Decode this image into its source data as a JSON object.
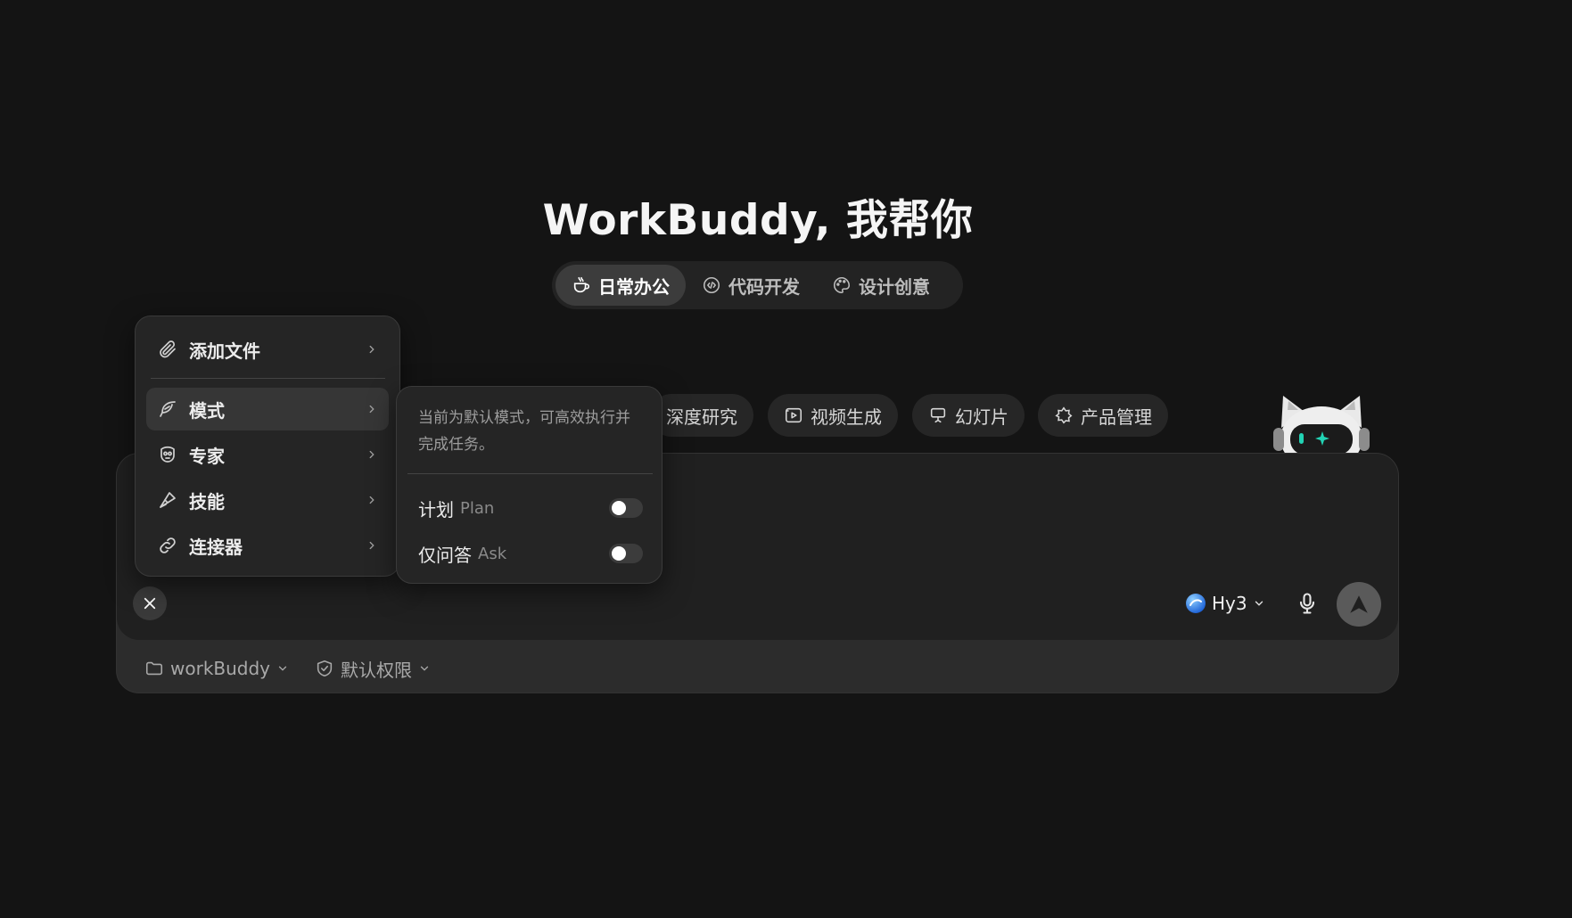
{
  "hero": {
    "title": "WorkBuddy, 我帮你"
  },
  "category_tabs": [
    {
      "label": "日常办公",
      "icon": "coffee-cup-icon",
      "active": true
    },
    {
      "label": "代码开发",
      "icon": "code-icon",
      "active": false
    },
    {
      "label": "设计创意",
      "icon": "palette-icon",
      "active": false
    }
  ],
  "chips": [
    {
      "label": "深度研究",
      "icon": ""
    },
    {
      "label": "视频生成",
      "icon": "video-icon"
    },
    {
      "label": "幻灯片",
      "icon": "presentation-icon"
    },
    {
      "label": "产品管理",
      "icon": "product-icon"
    }
  ],
  "menu": {
    "items": [
      {
        "label": "添加文件",
        "icon": "paperclip-icon"
      },
      {
        "label": "模式",
        "icon": "feather-icon",
        "active": true
      },
      {
        "label": "专家",
        "icon": "expert-icon"
      },
      {
        "label": "技能",
        "icon": "skill-icon"
      },
      {
        "label": "连接器",
        "icon": "link-icon"
      }
    ]
  },
  "submenu": {
    "description": "当前为默认模式，可高效执行并完成任务。",
    "toggles": [
      {
        "label": "计划",
        "en": "Plan",
        "on": false
      },
      {
        "label": "仅问答",
        "en": "Ask",
        "on": false
      }
    ]
  },
  "composer": {
    "model": "Hy3",
    "accent_color": "#2f7bf5"
  },
  "footer": {
    "workspace": "workBuddy",
    "permission": "默认权限"
  }
}
